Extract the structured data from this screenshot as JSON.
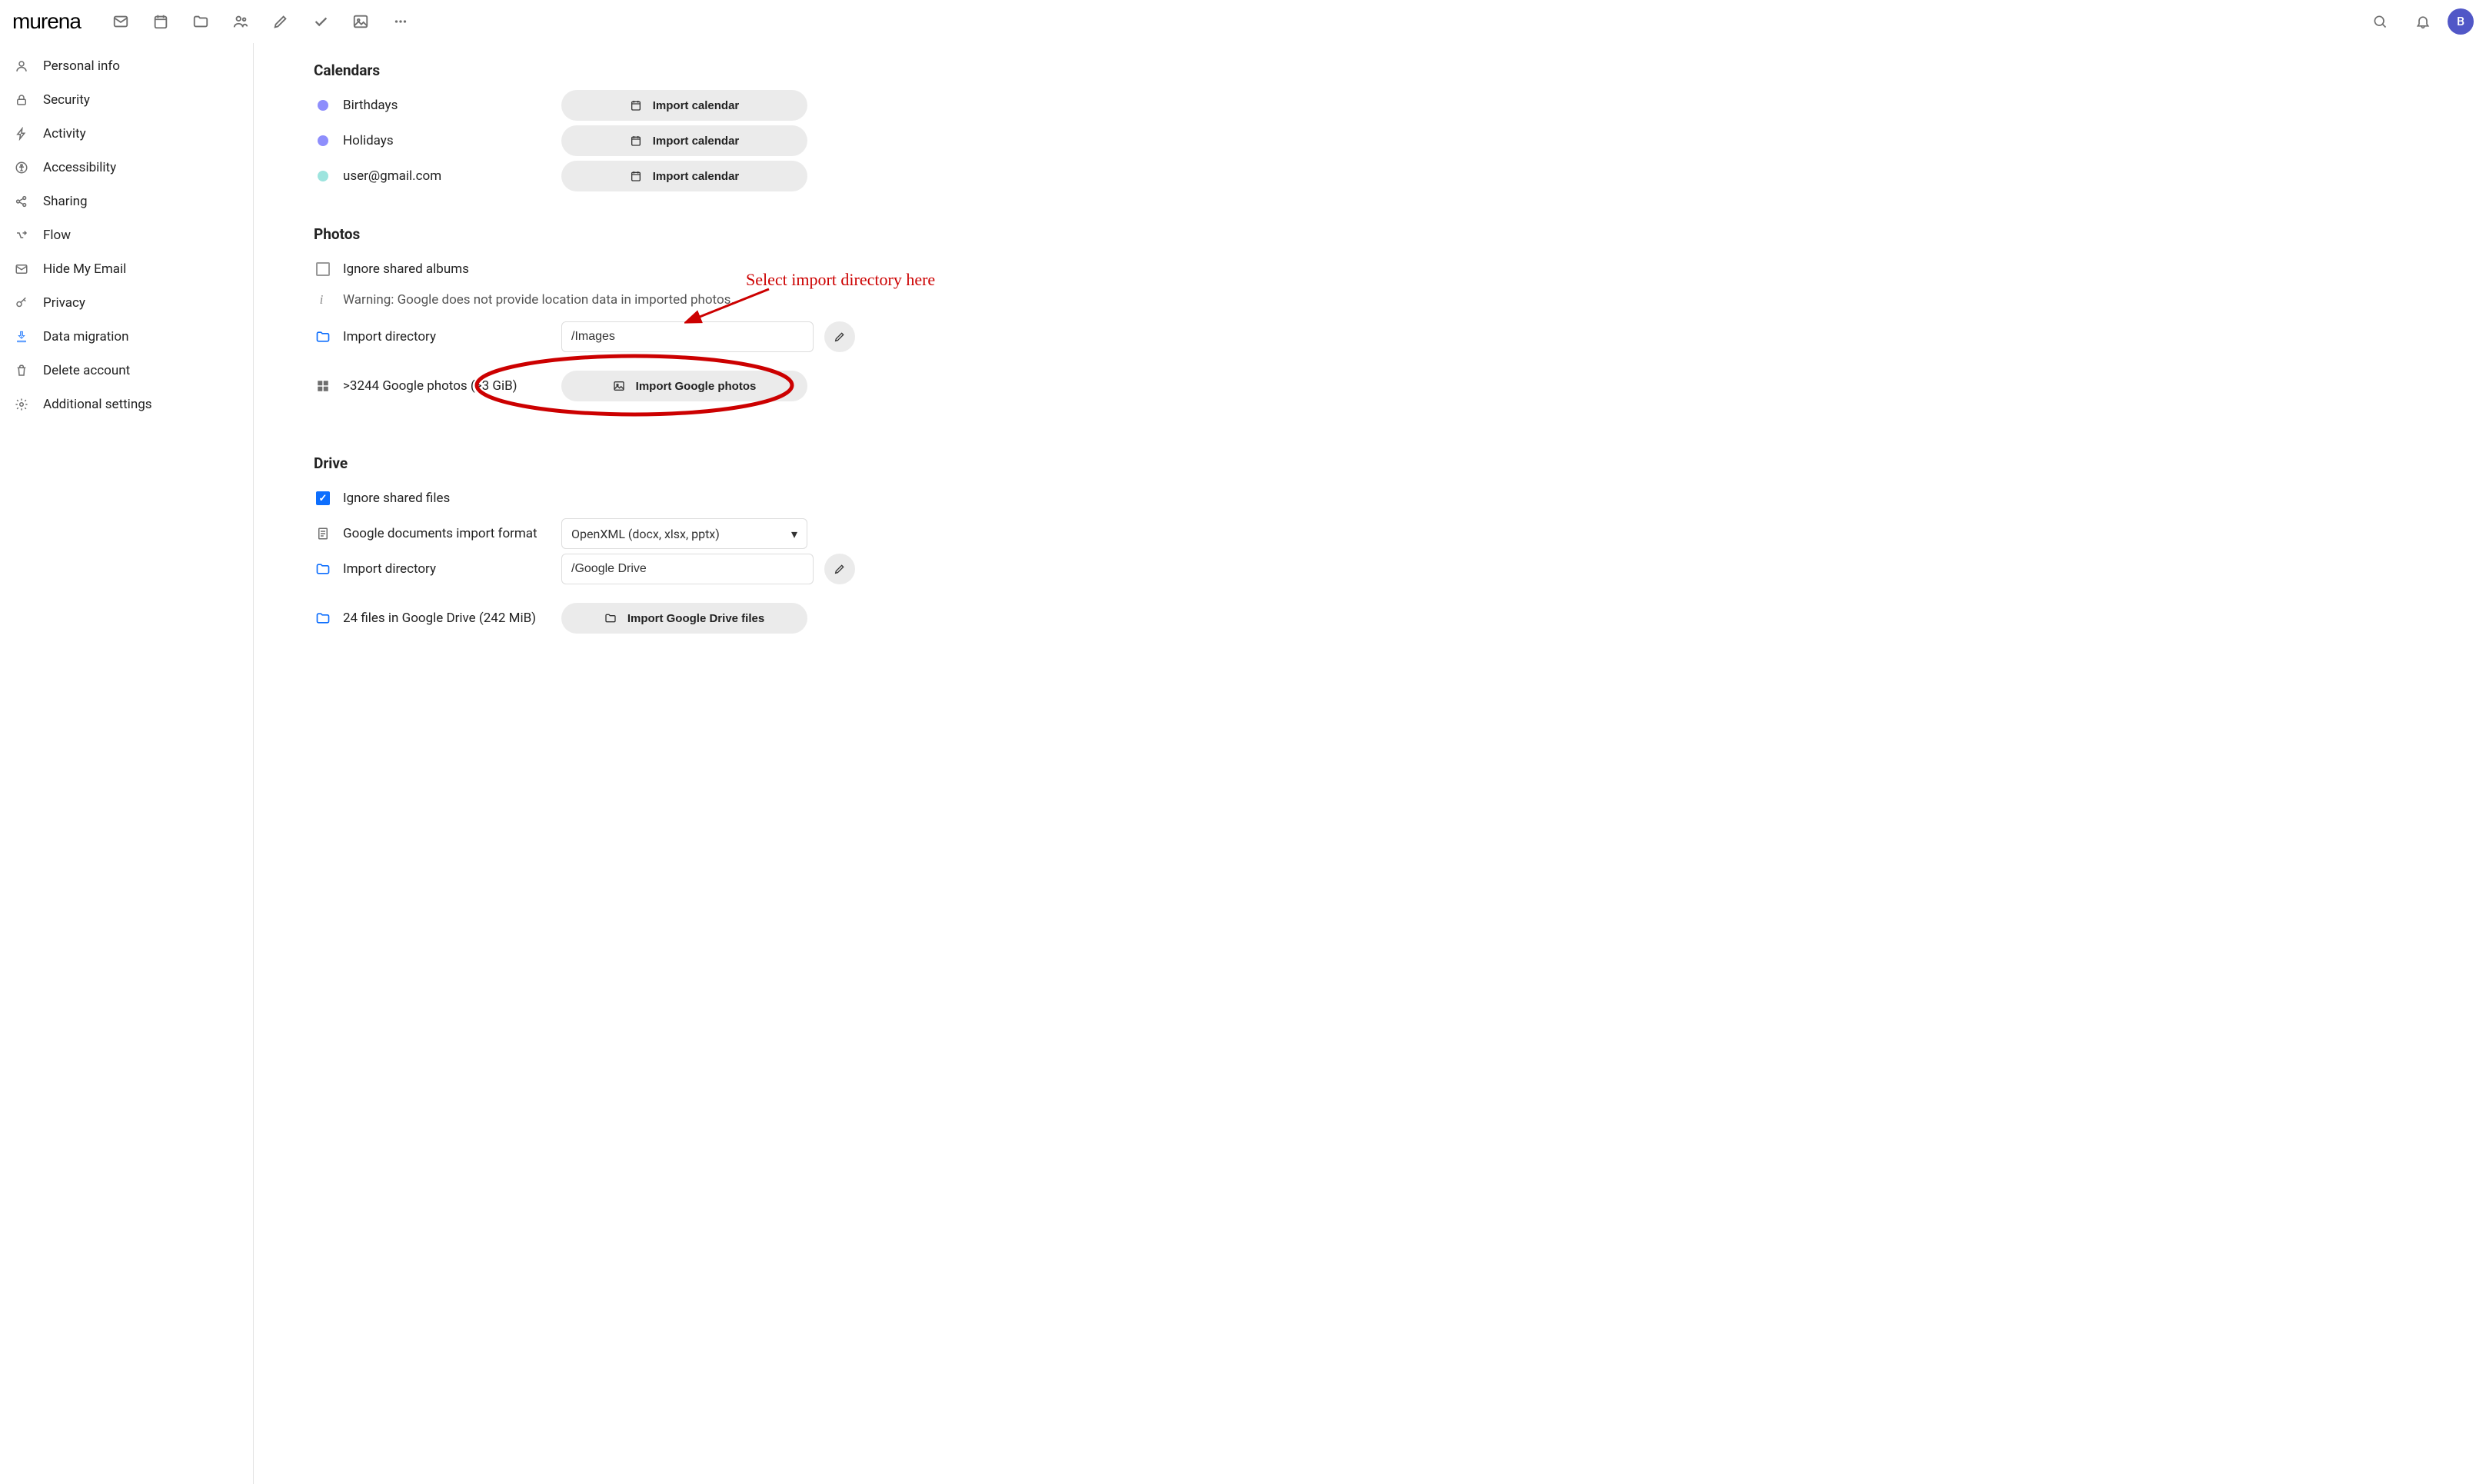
{
  "brand": "murena",
  "avatar_initial": "B",
  "sidebar": {
    "items": [
      {
        "label": "Personal info"
      },
      {
        "label": "Security"
      },
      {
        "label": "Activity"
      },
      {
        "label": "Accessibility"
      },
      {
        "label": "Sharing"
      },
      {
        "label": "Flow"
      },
      {
        "label": "Hide My Email"
      },
      {
        "label": "Privacy"
      },
      {
        "label": "Data migration"
      },
      {
        "label": "Delete account"
      },
      {
        "label": "Additional settings"
      }
    ]
  },
  "calendars": {
    "title": "Calendars",
    "items": [
      {
        "label": "Birthdays",
        "color": "#8e8efc"
      },
      {
        "label": "Holidays",
        "color": "#8e8efc"
      },
      {
        "label": "user@gmail.com",
        "color": "#9de4de"
      }
    ],
    "import_label": "Import calendar"
  },
  "photos": {
    "title": "Photos",
    "ignore_label": "Ignore shared albums",
    "ignore_checked": false,
    "warning": "Warning: Google does not provide location data in imported photos.",
    "import_dir_label": "Import directory",
    "import_dir_value": "/Images",
    "count_label": ">3244 Google photos (>3 GiB)",
    "import_btn": "Import Google photos"
  },
  "drive": {
    "title": "Drive",
    "ignore_label": "Ignore shared files",
    "ignore_checked": true,
    "doc_format_label": "Google documents import format",
    "doc_format_value": "OpenXML (docx, xlsx, pptx)",
    "import_dir_label": "Import directory",
    "import_dir_value": "/Google Drive",
    "files_label": "24 files in Google Drive (242 MiB)",
    "import_btn": "Import Google Drive files"
  },
  "annotation": {
    "text": "Select import directory here"
  }
}
